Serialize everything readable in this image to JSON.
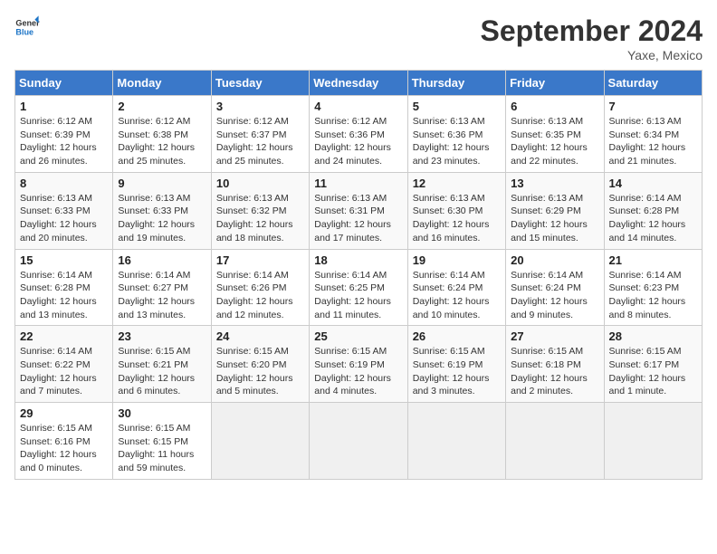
{
  "logo": {
    "line1": "General",
    "line2": "Blue"
  },
  "title": "September 2024",
  "location": "Yaxe, Mexico",
  "days_header": [
    "Sunday",
    "Monday",
    "Tuesday",
    "Wednesday",
    "Thursday",
    "Friday",
    "Saturday"
  ],
  "weeks": [
    [
      {
        "num": "1",
        "sunrise": "6:12 AM",
        "sunset": "6:39 PM",
        "daylight": "12 hours and 26 minutes."
      },
      {
        "num": "2",
        "sunrise": "6:12 AM",
        "sunset": "6:38 PM",
        "daylight": "12 hours and 25 minutes."
      },
      {
        "num": "3",
        "sunrise": "6:12 AM",
        "sunset": "6:37 PM",
        "daylight": "12 hours and 25 minutes."
      },
      {
        "num": "4",
        "sunrise": "6:12 AM",
        "sunset": "6:36 PM",
        "daylight": "12 hours and 24 minutes."
      },
      {
        "num": "5",
        "sunrise": "6:13 AM",
        "sunset": "6:36 PM",
        "daylight": "12 hours and 23 minutes."
      },
      {
        "num": "6",
        "sunrise": "6:13 AM",
        "sunset": "6:35 PM",
        "daylight": "12 hours and 22 minutes."
      },
      {
        "num": "7",
        "sunrise": "6:13 AM",
        "sunset": "6:34 PM",
        "daylight": "12 hours and 21 minutes."
      }
    ],
    [
      {
        "num": "8",
        "sunrise": "6:13 AM",
        "sunset": "6:33 PM",
        "daylight": "12 hours and 20 minutes."
      },
      {
        "num": "9",
        "sunrise": "6:13 AM",
        "sunset": "6:33 PM",
        "daylight": "12 hours and 19 minutes."
      },
      {
        "num": "10",
        "sunrise": "6:13 AM",
        "sunset": "6:32 PM",
        "daylight": "12 hours and 18 minutes."
      },
      {
        "num": "11",
        "sunrise": "6:13 AM",
        "sunset": "6:31 PM",
        "daylight": "12 hours and 17 minutes."
      },
      {
        "num": "12",
        "sunrise": "6:13 AM",
        "sunset": "6:30 PM",
        "daylight": "12 hours and 16 minutes."
      },
      {
        "num": "13",
        "sunrise": "6:13 AM",
        "sunset": "6:29 PM",
        "daylight": "12 hours and 15 minutes."
      },
      {
        "num": "14",
        "sunrise": "6:14 AM",
        "sunset": "6:28 PM",
        "daylight": "12 hours and 14 minutes."
      }
    ],
    [
      {
        "num": "15",
        "sunrise": "6:14 AM",
        "sunset": "6:28 PM",
        "daylight": "12 hours and 13 minutes."
      },
      {
        "num": "16",
        "sunrise": "6:14 AM",
        "sunset": "6:27 PM",
        "daylight": "12 hours and 13 minutes."
      },
      {
        "num": "17",
        "sunrise": "6:14 AM",
        "sunset": "6:26 PM",
        "daylight": "12 hours and 12 minutes."
      },
      {
        "num": "18",
        "sunrise": "6:14 AM",
        "sunset": "6:25 PM",
        "daylight": "12 hours and 11 minutes."
      },
      {
        "num": "19",
        "sunrise": "6:14 AM",
        "sunset": "6:24 PM",
        "daylight": "12 hours and 10 minutes."
      },
      {
        "num": "20",
        "sunrise": "6:14 AM",
        "sunset": "6:24 PM",
        "daylight": "12 hours and 9 minutes."
      },
      {
        "num": "21",
        "sunrise": "6:14 AM",
        "sunset": "6:23 PM",
        "daylight": "12 hours and 8 minutes."
      }
    ],
    [
      {
        "num": "22",
        "sunrise": "6:14 AM",
        "sunset": "6:22 PM",
        "daylight": "12 hours and 7 minutes."
      },
      {
        "num": "23",
        "sunrise": "6:15 AM",
        "sunset": "6:21 PM",
        "daylight": "12 hours and 6 minutes."
      },
      {
        "num": "24",
        "sunrise": "6:15 AM",
        "sunset": "6:20 PM",
        "daylight": "12 hours and 5 minutes."
      },
      {
        "num": "25",
        "sunrise": "6:15 AM",
        "sunset": "6:19 PM",
        "daylight": "12 hours and 4 minutes."
      },
      {
        "num": "26",
        "sunrise": "6:15 AM",
        "sunset": "6:19 PM",
        "daylight": "12 hours and 3 minutes."
      },
      {
        "num": "27",
        "sunrise": "6:15 AM",
        "sunset": "6:18 PM",
        "daylight": "12 hours and 2 minutes."
      },
      {
        "num": "28",
        "sunrise": "6:15 AM",
        "sunset": "6:17 PM",
        "daylight": "12 hours and 1 minute."
      }
    ],
    [
      {
        "num": "29",
        "sunrise": "6:15 AM",
        "sunset": "6:16 PM",
        "daylight": "12 hours and 0 minutes."
      },
      {
        "num": "30",
        "sunrise": "6:15 AM",
        "sunset": "6:15 PM",
        "daylight": "11 hours and 59 minutes."
      },
      null,
      null,
      null,
      null,
      null
    ]
  ]
}
